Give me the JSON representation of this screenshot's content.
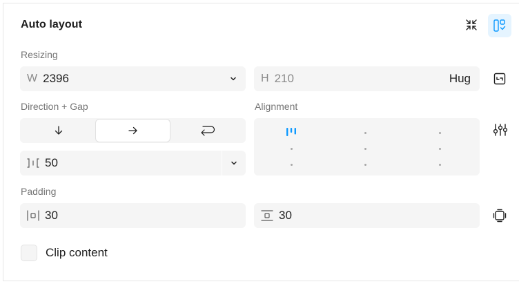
{
  "header": {
    "title": "Auto layout"
  },
  "resizing": {
    "label": "Resizing",
    "width": {
      "prefix": "W",
      "value": "2396"
    },
    "height": {
      "prefix": "H",
      "value": "210",
      "mode": "Hug"
    }
  },
  "direction": {
    "label": "Direction + Gap",
    "options": [
      "vertical",
      "horizontal",
      "wrap"
    ],
    "selected": "horizontal",
    "gap": {
      "value": "50"
    }
  },
  "alignment": {
    "label": "Alignment",
    "selected": "top-left"
  },
  "padding": {
    "label": "Padding",
    "horizontal": "30",
    "vertical": "30"
  },
  "clip": {
    "label": "Clip content",
    "checked": false
  },
  "colors": {
    "accent": "#0d99ff",
    "accent_bg": "#e5f4ff",
    "field_bg": "#f5f5f5"
  }
}
